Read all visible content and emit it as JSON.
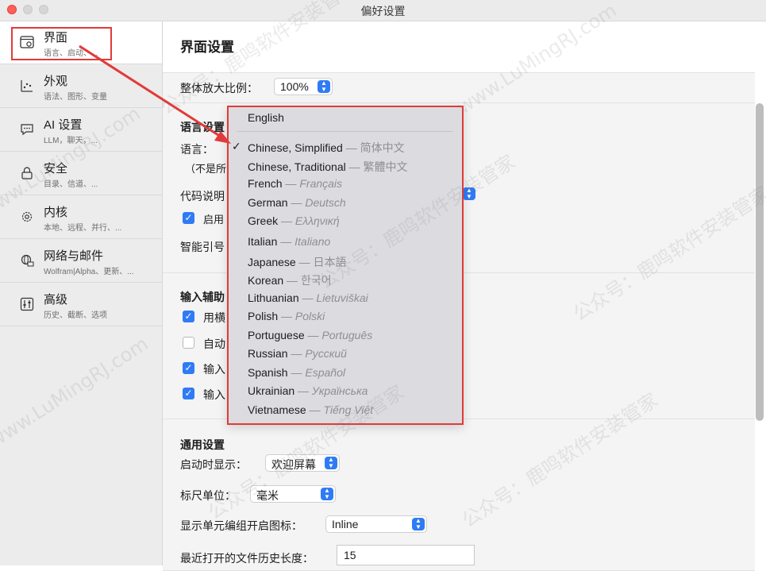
{
  "window": {
    "title": "偏好设置"
  },
  "sidebar": {
    "items": [
      {
        "label": "界面",
        "sub": "语言、启动、...",
        "icon": "window-gear-icon"
      },
      {
        "label": "外观",
        "sub": "语法、图形、变量",
        "icon": "chart-icon"
      },
      {
        "label": "AI 设置",
        "sub": "LLM，聊天，...",
        "icon": "chat-bubble-icon"
      },
      {
        "label": "安全",
        "sub": "目录、信道、...",
        "icon": "lock-icon"
      },
      {
        "label": "内核",
        "sub": "本地、远程、并行、...",
        "icon": "gear-icon"
      },
      {
        "label": "网络与邮件",
        "sub": "Wolfram|Alpha、更新、...",
        "icon": "globe-mail-icon"
      },
      {
        "label": "高级",
        "sub": "历史、截断、选项",
        "icon": "sliders-icon"
      }
    ]
  },
  "main": {
    "title": "界面设置",
    "zoom_label": "整体放大比例：",
    "zoom_value": "100%",
    "lang_header": "语言设置",
    "lang_label": "语言：",
    "lang_note": "（不是所",
    "code_label": "代码说明",
    "enable_label": "启用",
    "smart_quote_label": "智能引号",
    "input_header": "输入辅助",
    "input_opt1": "用横",
    "input_opt2": "自动",
    "input_opt3": "输入",
    "input_opt4": "输入",
    "general_header": "通用设置",
    "startup_label": "启动时显示：",
    "startup_value": "欢迎屏幕",
    "ruler_label": "标尺单位：",
    "ruler_value": "毫米",
    "cellgroup_label": "显示单元编组开启图标：",
    "cellgroup_value": "Inline",
    "history_label": "最近打开的文件历史长度：",
    "history_value": "15"
  },
  "language_menu": {
    "items": [
      {
        "name": "English",
        "native": ""
      },
      {
        "name": "Chinese, Simplified",
        "native": "简体中文",
        "checked": true
      },
      {
        "name": "Chinese, Traditional",
        "native": "繁體中文"
      },
      {
        "name": "French",
        "native": "Français"
      },
      {
        "name": "German",
        "native": "Deutsch"
      },
      {
        "name": "Greek",
        "native": "Ελληνική"
      },
      {
        "name": "Italian",
        "native": "Italiano"
      },
      {
        "name": "Japanese",
        "native": "日本語"
      },
      {
        "name": "Korean",
        "native": "한국어"
      },
      {
        "name": "Lithuanian",
        "native": "Lietuviškai"
      },
      {
        "name": "Polish",
        "native": "Polski"
      },
      {
        "name": "Portuguese",
        "native": "Português"
      },
      {
        "name": "Russian",
        "native": "Русский"
      },
      {
        "name": "Spanish",
        "native": "Español"
      },
      {
        "name": "Ukrainian",
        "native": "Українська"
      },
      {
        "name": "Vietnamese",
        "native": "Tiếng Việt"
      }
    ],
    "check_glyph": "✓",
    "dash": "—"
  },
  "watermark": {
    "text1": "公众号：鹿鸣软件安装管家",
    "text2": "www.LuMingRJ.com"
  },
  "colors": {
    "accent": "#2f7bf6",
    "annotation": "#e23a3a"
  }
}
